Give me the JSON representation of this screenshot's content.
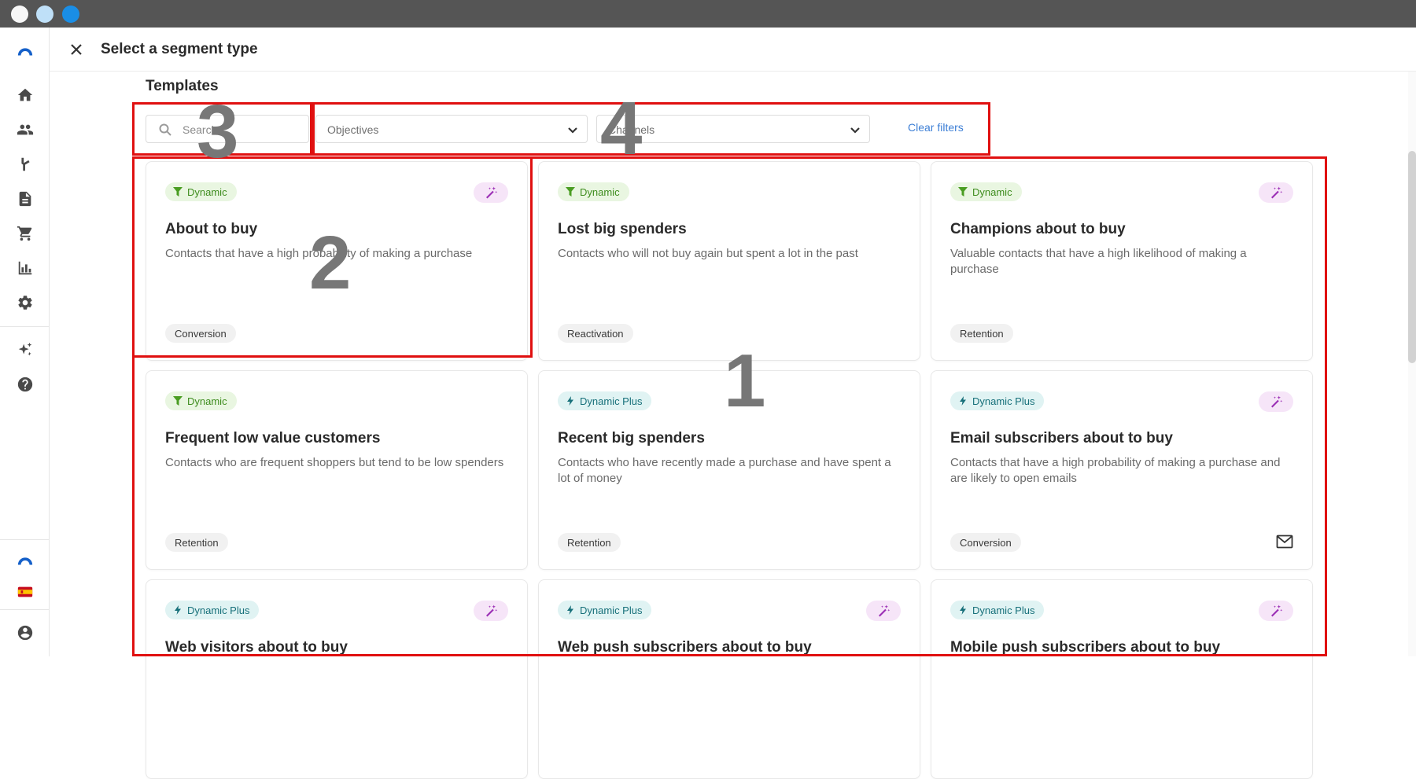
{
  "window": {
    "controls": [
      "close",
      "minimize",
      "maximize"
    ]
  },
  "rail": {
    "items": [
      {
        "name": "home-icon"
      },
      {
        "name": "contacts-icon"
      },
      {
        "name": "journeys-icon"
      },
      {
        "name": "content-icon"
      },
      {
        "name": "commerce-icon"
      },
      {
        "name": "reports-icon"
      },
      {
        "name": "settings-icon"
      },
      {
        "name": "ai-sparkle-icon"
      },
      {
        "name": "help-icon"
      },
      {
        "name": "brand-logo"
      },
      {
        "name": "spain-flag-icon"
      },
      {
        "name": "account-icon"
      }
    ]
  },
  "header": {
    "title": "Select a segment type"
  },
  "templates": {
    "title": "Templates",
    "search": {
      "placeholder": "Search",
      "value": ""
    },
    "objectives": {
      "value": "Objectives"
    },
    "channels": {
      "value": "Channels"
    },
    "clear_filters": "Clear filters"
  },
  "cards": [
    {
      "type": "Dynamic",
      "ai": true,
      "title": "About to buy",
      "description": "Contacts that have a high probability of making a purchase",
      "tag": "Conversion",
      "email": false
    },
    {
      "type": "Dynamic",
      "ai": false,
      "title": "Lost big spenders",
      "description": "Contacts who will not buy again but spent a lot in the past",
      "tag": "Reactivation",
      "email": false
    },
    {
      "type": "Dynamic",
      "ai": true,
      "title": "Champions about to buy",
      "description": "Valuable contacts that have a high likelihood of making a purchase",
      "tag": "Retention",
      "email": false
    },
    {
      "type": "Dynamic",
      "ai": false,
      "title": "Frequent low value customers",
      "description": "Contacts who are frequent shoppers but tend to be low spenders",
      "tag": "Retention",
      "email": false
    },
    {
      "type": "Dynamic Plus",
      "ai": false,
      "title": "Recent big spenders",
      "description": "Contacts who have recently made a purchase and have spent a lot of money",
      "tag": "Retention",
      "email": false
    },
    {
      "type": "Dynamic Plus",
      "ai": true,
      "title": "Email subscribers about to buy",
      "description": "Contacts that have a high probability of making a purchase and are likely to open emails",
      "tag": "Conversion",
      "email": true
    },
    {
      "type": "Dynamic Plus",
      "ai": true,
      "title": "Web visitors about to buy",
      "description": "",
      "tag": "",
      "email": false
    },
    {
      "type": "Dynamic Plus",
      "ai": true,
      "title": "Web push subscribers about to buy",
      "description": "",
      "tag": "",
      "email": false
    },
    {
      "type": "Dynamic Plus",
      "ai": true,
      "title": "Mobile push subscribers about to buy",
      "description": "",
      "tag": "",
      "email": false
    }
  ],
  "annotations": {
    "labels": [
      "1",
      "2",
      "3",
      "4"
    ],
    "color": "#e01010"
  }
}
